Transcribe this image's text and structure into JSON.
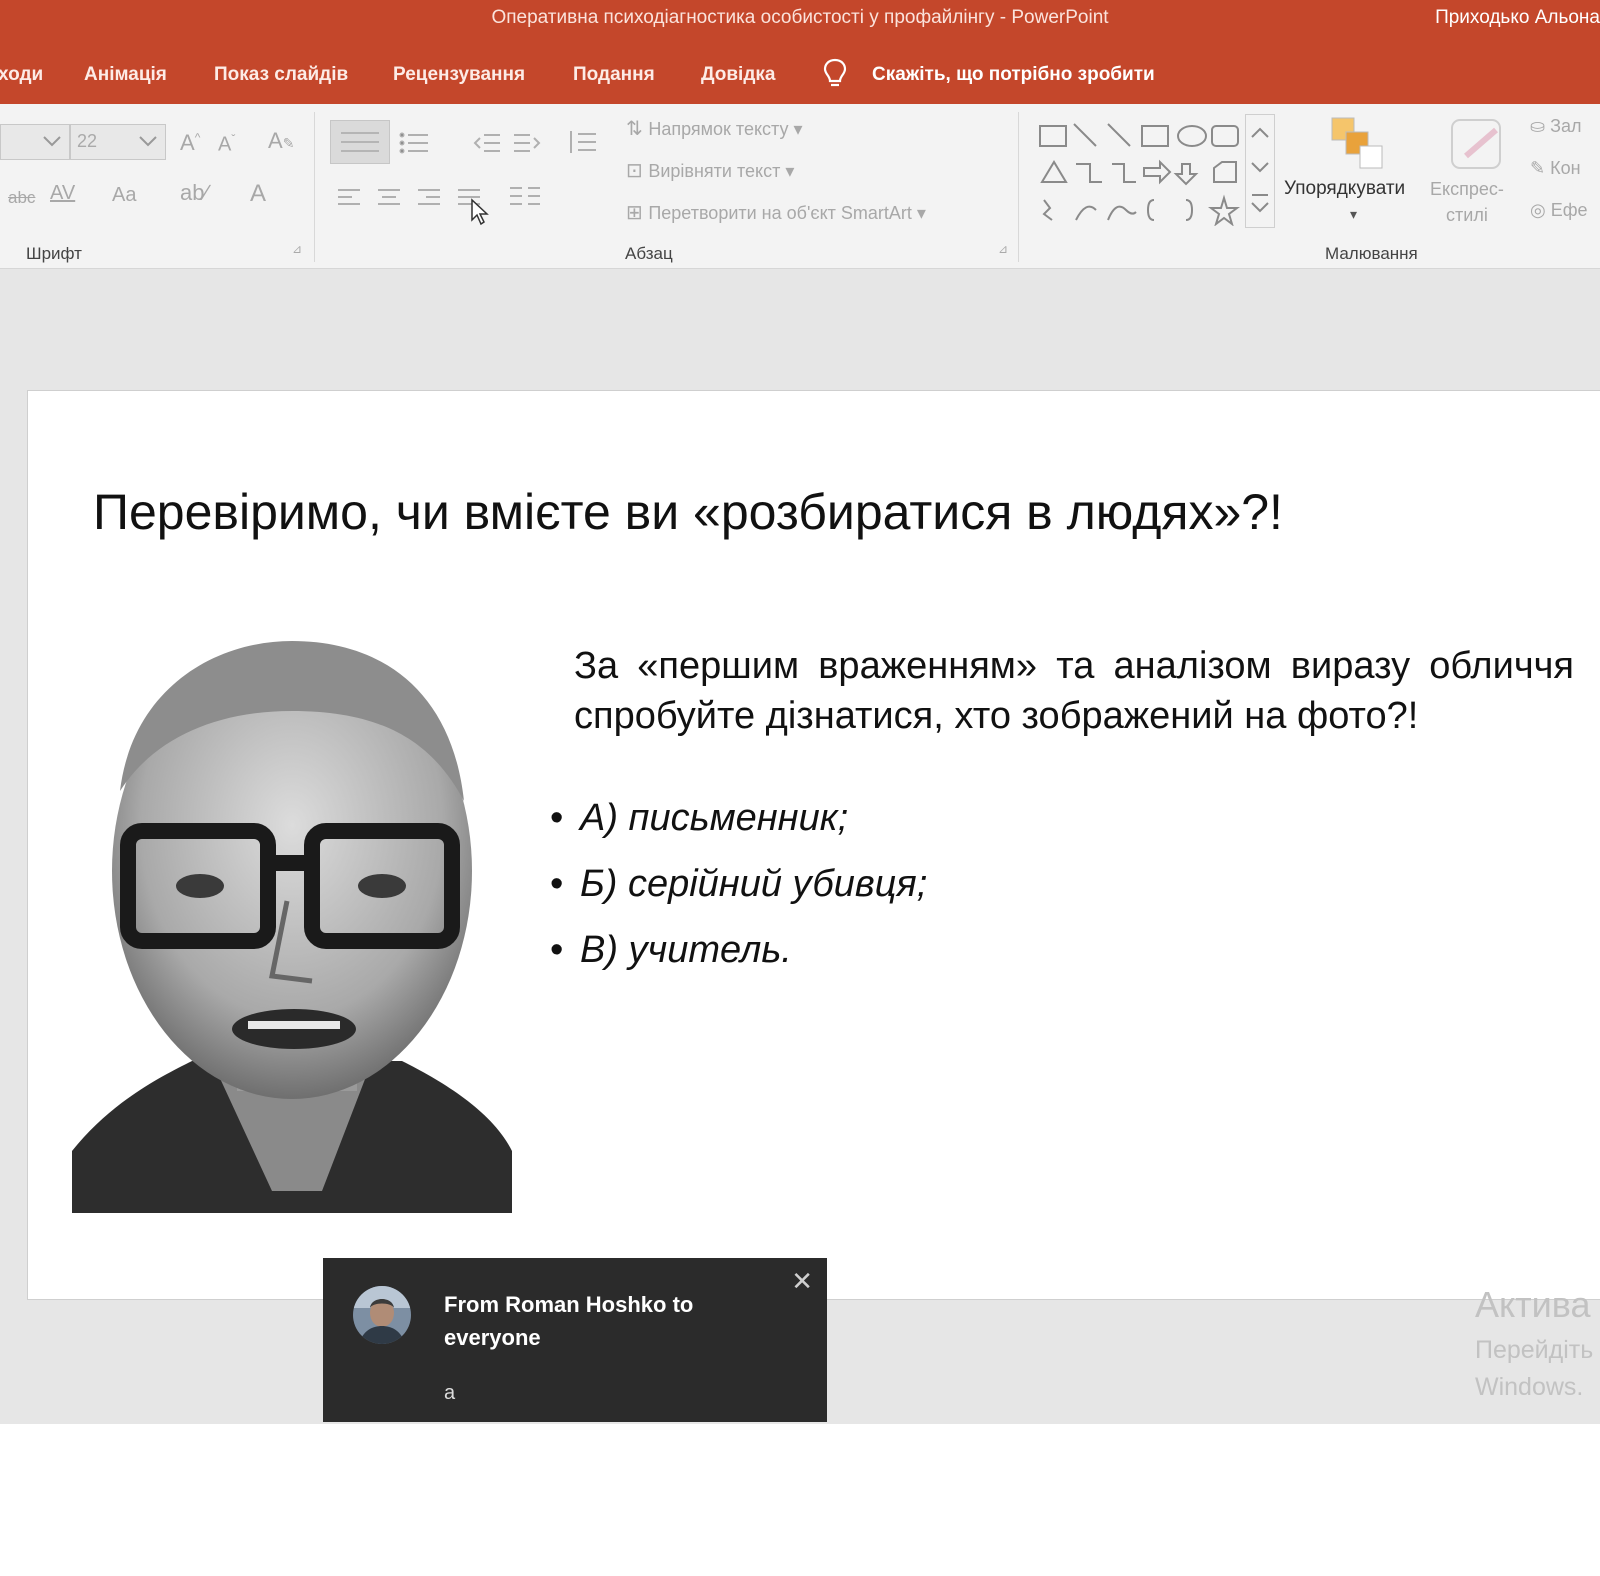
{
  "window": {
    "title": "Оперативна психодіагностика особистості у профайлінгу  -  PowerPoint",
    "user": "Приходько Альона"
  },
  "menu": {
    "tabs": [
      "ходи",
      "Анімація",
      "Показ слайдів",
      "Рецензування",
      "Подання",
      "Довідка"
    ],
    "tell_me": "Скажіть, що потрібно зробити"
  },
  "ribbon": {
    "font_size": "22",
    "font_size_dropdown": "",
    "paragraph": {
      "text_direction": "Напрямок тексту",
      "align_text": "Вирівняти текст",
      "convert_smartart": "Перетворити на об'єкт SmartArt"
    },
    "drawing": {
      "arrange": "Упорядкувати",
      "quick_styles": "Експрес-\nстилі",
      "fill": "Зал",
      "outline": "Кон",
      "effects": "Ефе"
    },
    "groups": {
      "font": "Шрифт",
      "paragraph": "Абзац",
      "drawing": "Малювання"
    },
    "font_controls": {
      "char_spacing": "AV",
      "change_case": "Aa",
      "font_color": "A",
      "strike": "abc"
    }
  },
  "slide": {
    "title": "Перевіримо, чи вмієте ви «розбиратися в людях»?!",
    "question": "За «першим враженням» та аналізом виразу обличчя спробуйте дізнатися, хто зображений на фото?!",
    "options": [
      "А) письменник;",
      "Б) серійний убивця;",
      "В) учитель."
    ],
    "bullet": "•"
  },
  "watermark": {
    "line1": "Актива",
    "line2": "Перейдіть",
    "line3": "Windows."
  },
  "chat_toast": {
    "from": "From Roman Hoshko to everyone",
    "message": "a",
    "close": "✕"
  },
  "colors": {
    "accent": "#c4472b",
    "toast_bg": "#2b2b2b",
    "workspace": "#e6e6e6"
  }
}
